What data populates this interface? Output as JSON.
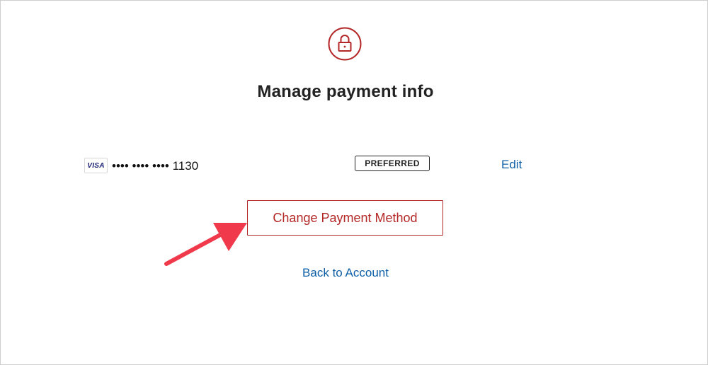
{
  "page": {
    "title": "Manage payment info"
  },
  "payment_method": {
    "brand": "VISA",
    "masked_number": "•••• •••• •••• 1130",
    "badge": "PREFERRED",
    "edit_label": "Edit"
  },
  "actions": {
    "change_payment_label": "Change Payment Method",
    "back_label": "Back to Account"
  },
  "icons": {
    "header": "lock-icon",
    "annotation": "arrow-pointer-icon"
  },
  "colors": {
    "brand_red": "#b42727",
    "link_blue": "#0f5fa6",
    "arrow_red": "#f0394b",
    "text_dark": "#222222"
  }
}
